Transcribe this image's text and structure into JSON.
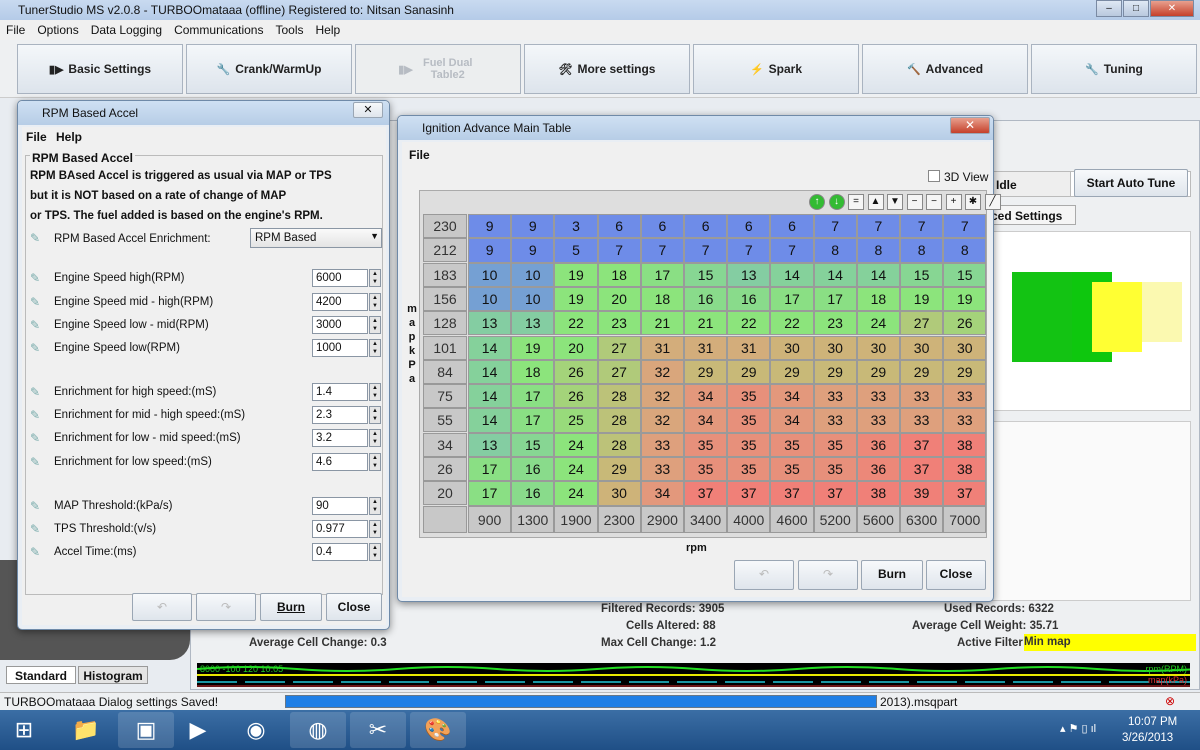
{
  "app": {
    "title": "TunerStudio MS v2.0.8 - TURBOOmataaa (offline) Registered to: Nitsan Sanasinh"
  },
  "menu": [
    "File",
    "Options",
    "Data Logging",
    "Communications",
    "Tools",
    "Help"
  ],
  "toolbar": [
    {
      "label": "Basic Settings",
      "icon": "engine-icon"
    },
    {
      "label": "Crank/WarmUp",
      "icon": "wrench-icon"
    },
    {
      "label": "Fuel Dual Table2",
      "icon": "injector-icon",
      "disabled": true
    },
    {
      "label": "More settings",
      "icon": "tools-icon"
    },
    {
      "label": "Spark",
      "icon": "spark-plug-icon"
    },
    {
      "label": "Advanced",
      "icon": "hammer-icon"
    },
    {
      "label": "Tuning",
      "icon": "wrench-icon"
    }
  ],
  "rpm_dialog": {
    "title": "RPM Based Accel",
    "menu": [
      "File",
      "Help"
    ],
    "group": "RPM Based Accel",
    "description": [
      "RPM BAsed Accel is triggered as usual via MAP or TPS",
      "but it is NOT based on a rate of change of MAP",
      "or TPS. The fuel added is based on the engine's RPM."
    ],
    "enrichment_label": "RPM Based Accel Enrichment:",
    "enrichment_value": "RPM Based",
    "fields": [
      {
        "label": "Engine Speed high(RPM)",
        "value": "6000"
      },
      {
        "label": "Engine Speed mid - high(RPM)",
        "value": "4200"
      },
      {
        "label": "Engine Speed low - mid(RPM)",
        "value": "3000"
      },
      {
        "label": "Engine Speed low(RPM)",
        "value": "1000"
      },
      {
        "label": "Enrichment for high speed:(mS)",
        "value": "1.4"
      },
      {
        "label": "Enrichment for mid - high speed:(mS)",
        "value": "2.3"
      },
      {
        "label": "Enrichment for low - mid speed:(mS)",
        "value": "3.2"
      },
      {
        "label": "Enrichment for low speed:(mS)",
        "value": "4.6"
      },
      {
        "label": "MAP Threshold:(kPa/s)",
        "value": "90"
      },
      {
        "label": "TPS Threshold:(v/s)",
        "value": "0.977"
      },
      {
        "label": "Accel Time:(ms)",
        "value": "0.4"
      }
    ],
    "burn": "Burn",
    "close": "Close"
  },
  "ign_window": {
    "title": "Ignition Advance Main Table",
    "menu": "File",
    "view3d": "3D View",
    "yaxis": "m a p  k P a",
    "xaxis": "rpm",
    "burn": "Burn",
    "close": "Close",
    "map": [
      "230",
      "212",
      "183",
      "156",
      "128",
      "101",
      "84",
      "75",
      "55",
      "34",
      "26",
      "20"
    ],
    "rpm": [
      "900",
      "1300",
      "1900",
      "2300",
      "2900",
      "3400",
      "4000",
      "4600",
      "5200",
      "5600",
      "6300",
      "7000"
    ],
    "values": [
      [
        9,
        9,
        3,
        6,
        6,
        6,
        6,
        6,
        7,
        7,
        7,
        7
      ],
      [
        9,
        9,
        5,
        7,
        7,
        7,
        7,
        7,
        8,
        8,
        8,
        8
      ],
      [
        10,
        10,
        19,
        18,
        17,
        15,
        13,
        14,
        14,
        14,
        15,
        15
      ],
      [
        10,
        10,
        19,
        20,
        18,
        16,
        16,
        17,
        17,
        18,
        19,
        19
      ],
      [
        13,
        13,
        22,
        23,
        21,
        21,
        22,
        22,
        23,
        24,
        27,
        26
      ],
      [
        14,
        19,
        20,
        27,
        31,
        31,
        31,
        30,
        30,
        30,
        30,
        30
      ],
      [
        14,
        18,
        26,
        27,
        32,
        29,
        29,
        29,
        29,
        29,
        29,
        29
      ],
      [
        14,
        17,
        26,
        28,
        32,
        34,
        35,
        34,
        33,
        33,
        33,
        33
      ],
      [
        14,
        17,
        25,
        28,
        32,
        34,
        35,
        34,
        33,
        33,
        33,
        33
      ],
      [
        13,
        15,
        24,
        28,
        33,
        35,
        35,
        35,
        35,
        36,
        37,
        38
      ],
      [
        17,
        16,
        24,
        29,
        33,
        35,
        35,
        35,
        35,
        36,
        37,
        38
      ],
      [
        17,
        16,
        24,
        30,
        34,
        37,
        37,
        37,
        37,
        38,
        39,
        37
      ]
    ]
  },
  "autotune": {
    "idle": "Idle",
    "start": "Start Auto Tune",
    "tab": "ced Settings",
    "stats": {
      "filtered": "Filtered Records: 3905",
      "used": "Used Records: 6322",
      "cells_altered": "Cells Altered: 88",
      "avg_weight": "Average Cell Weight: 35.71",
      "avg_change": "Average Cell Change: 0.3",
      "max_change": "Max Cell Change: 1.2",
      "filter_label": "Active Filter:",
      "filter_value": "Min map"
    }
  },
  "left_tabs": [
    "Standard",
    "Histogram"
  ],
  "strip": {
    "left": "8000  -100  120  10.05",
    "right1": "rpm(RPM)",
    "right2": "map(kPa)"
  },
  "status": {
    "message": "TURBOOmataaa Dialog settings Saved!",
    "file": "2013).msqpart",
    "progress": 100
  },
  "clock": {
    "time": "10:07 PM",
    "date": "3/26/2013"
  },
  "colors": {
    "low": "#6f8fe6",
    "mid": "#8ee47c",
    "high": "#f08078",
    "filter": "#ffff00"
  }
}
